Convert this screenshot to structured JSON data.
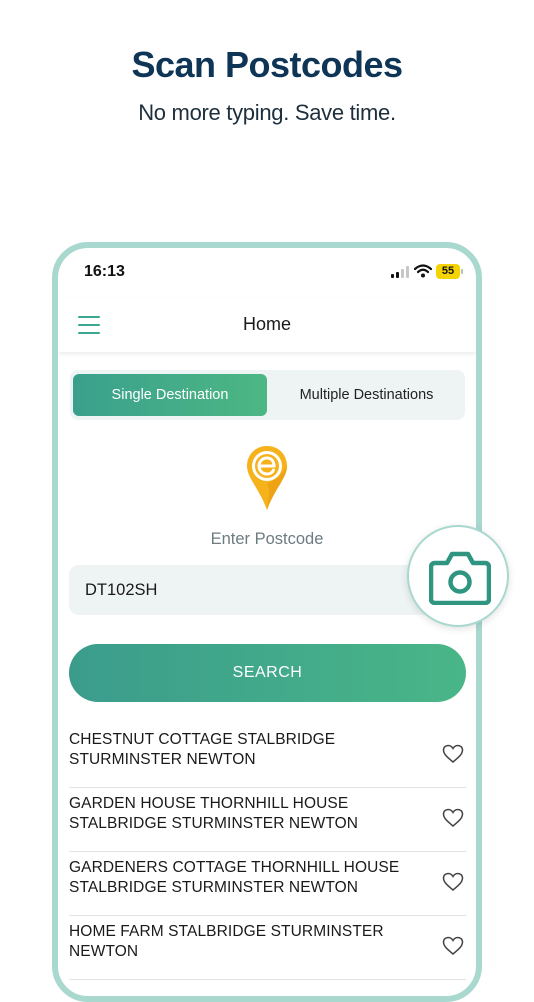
{
  "promo": {
    "headline": "Scan Postcodes",
    "subheadline": "No more typing. Save time."
  },
  "status_bar": {
    "time": "16:13",
    "battery": "55"
  },
  "nav": {
    "title": "Home"
  },
  "tabs": [
    {
      "label": "Single Destination",
      "active": true
    },
    {
      "label": "Multiple Destinations",
      "active": false
    }
  ],
  "postcode": {
    "label": "Enter Postcode",
    "value": "DT102SH"
  },
  "search_button": "SEARCH",
  "results": [
    {
      "address": "CHESTNUT COTTAGE STALBRIDGE STURMINSTER NEWTON"
    },
    {
      "address": "GARDEN HOUSE THORNHILL HOUSE STALBRIDGE STURMINSTER NEWTON"
    },
    {
      "address": "GARDENERS COTTAGE THORNHILL HOUSE STALBRIDGE STURMINSTER NEWTON"
    },
    {
      "address": "HOME FARM STALBRIDGE STURMINSTER NEWTON"
    }
  ],
  "colors": {
    "brand_teal": "#3aa08d",
    "brand_green": "#4db783",
    "headline_navy": "#0e3556",
    "battery_yellow": "#f4d300",
    "pin_orange": "#f6b21a"
  },
  "icons": {
    "menu": "hamburger-icon",
    "pin": "location-pin-logo",
    "camera": "camera-icon",
    "favorite": "heart-outline-icon"
  }
}
